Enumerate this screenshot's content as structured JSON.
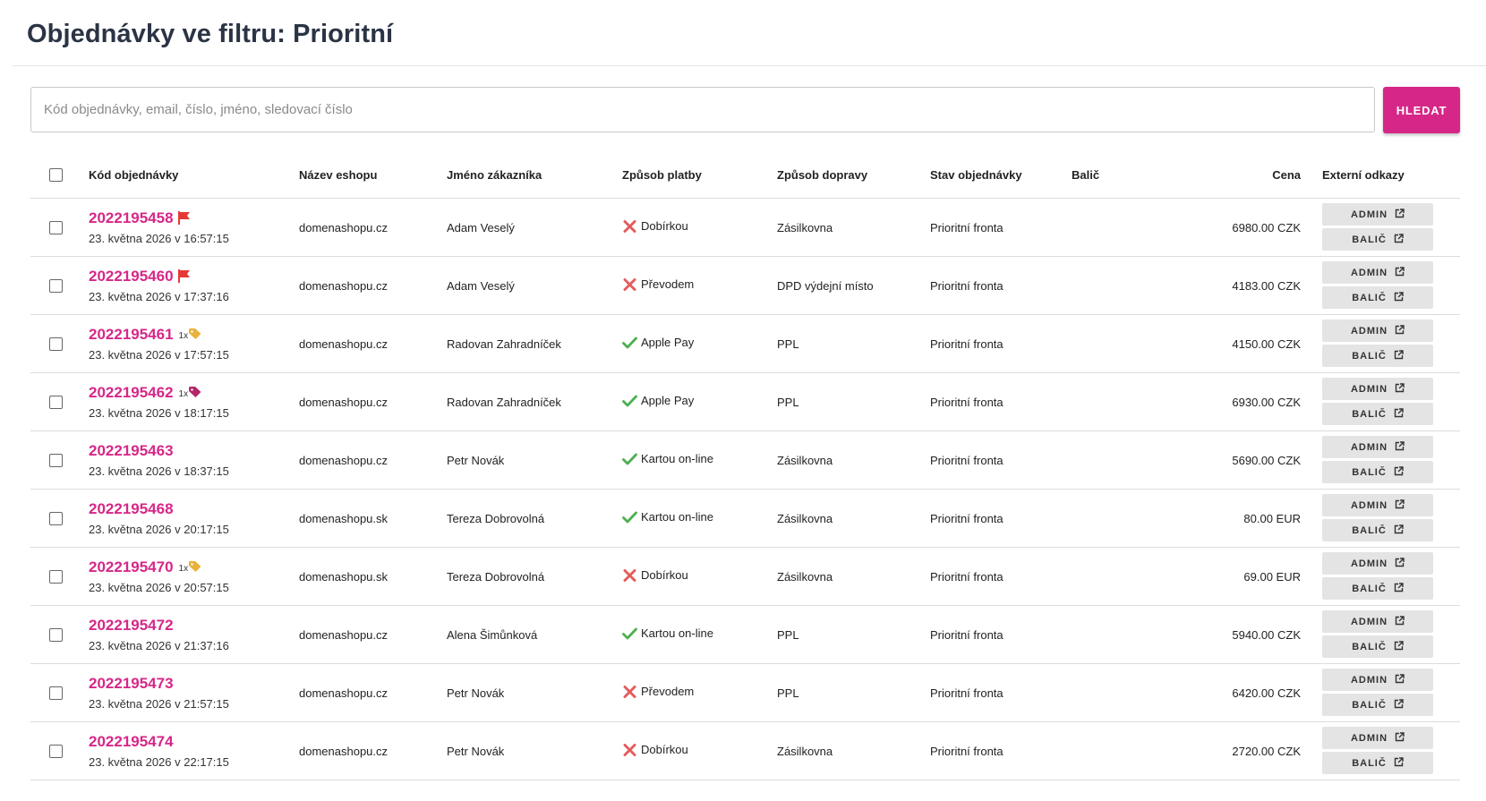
{
  "header": {
    "title": "Objednávky ve filtru: Prioritní"
  },
  "search": {
    "placeholder": "Kód objednávky, email, číslo, jméno, sledovací číslo",
    "value": "",
    "button_label": "HLEDAT"
  },
  "table": {
    "columns": {
      "code": "Kód objednávky",
      "eshop": "Název eshopu",
      "customer": "Jméno zákazníka",
      "payment": "Způsob platby",
      "delivery": "Způsob dopravy",
      "status": "Stav objednávky",
      "packer": "Balič",
      "price": "Cena",
      "links": "Externí odkazy"
    },
    "link_labels": {
      "admin": "ADMIN",
      "packer": "BALIČ"
    },
    "rows": [
      {
        "code": "2022195458",
        "flag": true,
        "tag": null,
        "date": "23. května 2026 v 16:57:15",
        "eshop": "domenashopu.cz",
        "customer": "Adam Veselý",
        "paid": false,
        "payment": "Dobírkou",
        "delivery": "Zásilkovna",
        "status": "Prioritní fronta",
        "packer": "",
        "price": "6980.00 CZK"
      },
      {
        "code": "2022195460",
        "flag": true,
        "tag": null,
        "date": "23. května 2026 v 17:37:16",
        "eshop": "domenashopu.cz",
        "customer": "Adam Veselý",
        "paid": false,
        "payment": "Převodem",
        "delivery": "DPD výdejní místo",
        "status": "Prioritní fronta",
        "packer": "",
        "price": "4183.00 CZK"
      },
      {
        "code": "2022195461",
        "flag": false,
        "tag": {
          "count": "1x",
          "color": "#e8b23a"
        },
        "date": "23. května 2026 v 17:57:15",
        "eshop": "domenashopu.cz",
        "customer": "Radovan Zahradníček",
        "paid": true,
        "payment": "Apple Pay",
        "delivery": "PPL",
        "status": "Prioritní fronta",
        "packer": "",
        "price": "4150.00 CZK"
      },
      {
        "code": "2022195462",
        "flag": false,
        "tag": {
          "count": "1x",
          "color": "#b5266b"
        },
        "date": "23. května 2026 v 18:17:15",
        "eshop": "domenashopu.cz",
        "customer": "Radovan Zahradníček",
        "paid": true,
        "payment": "Apple Pay",
        "delivery": "PPL",
        "status": "Prioritní fronta",
        "packer": "",
        "price": "6930.00 CZK"
      },
      {
        "code": "2022195463",
        "flag": false,
        "tag": null,
        "date": "23. května 2026 v 18:37:15",
        "eshop": "domenashopu.cz",
        "customer": "Petr Novák",
        "paid": true,
        "payment": "Kartou on-line",
        "delivery": "Zásilkovna",
        "status": "Prioritní fronta",
        "packer": "",
        "price": "5690.00 CZK"
      },
      {
        "code": "2022195468",
        "flag": false,
        "tag": null,
        "date": "23. května 2026 v 20:17:15",
        "eshop": "domenashopu.sk",
        "customer": "Tereza Dobrovolná",
        "paid": true,
        "payment": "Kartou on-line",
        "delivery": "Zásilkovna",
        "status": "Prioritní fronta",
        "packer": "",
        "price": "80.00 EUR"
      },
      {
        "code": "2022195470",
        "flag": false,
        "tag": {
          "count": "1x",
          "color": "#e8b23a"
        },
        "date": "23. května 2026 v 20:57:15",
        "eshop": "domenashopu.sk",
        "customer": "Tereza Dobrovolná",
        "paid": false,
        "payment": "Dobírkou",
        "delivery": "Zásilkovna",
        "status": "Prioritní fronta",
        "packer": "",
        "price": "69.00 EUR"
      },
      {
        "code": "2022195472",
        "flag": false,
        "tag": null,
        "date": "23. května 2026 v 21:37:16",
        "eshop": "domenashopu.cz",
        "customer": "Alena Šimůnková",
        "paid": true,
        "payment": "Kartou on-line",
        "delivery": "PPL",
        "status": "Prioritní fronta",
        "packer": "",
        "price": "5940.00 CZK"
      },
      {
        "code": "2022195473",
        "flag": false,
        "tag": null,
        "date": "23. května 2026 v 21:57:15",
        "eshop": "domenashopu.cz",
        "customer": "Petr Novák",
        "paid": false,
        "payment": "Převodem",
        "delivery": "PPL",
        "status": "Prioritní fronta",
        "packer": "",
        "price": "6420.00 CZK"
      },
      {
        "code": "2022195474",
        "flag": false,
        "tag": null,
        "date": "23. května 2026 v 22:17:15",
        "eshop": "domenashopu.cz",
        "customer": "Petr Novák",
        "paid": false,
        "payment": "Dobírkou",
        "delivery": "Zásilkovna",
        "status": "Prioritní fronta",
        "packer": "",
        "price": "2720.00 CZK"
      }
    ]
  },
  "colors": {
    "accent": "#d62788",
    "paid": "#4caf50",
    "unpaid": "#e35d5d",
    "flag": "#e53935",
    "title": "#2b3445"
  }
}
